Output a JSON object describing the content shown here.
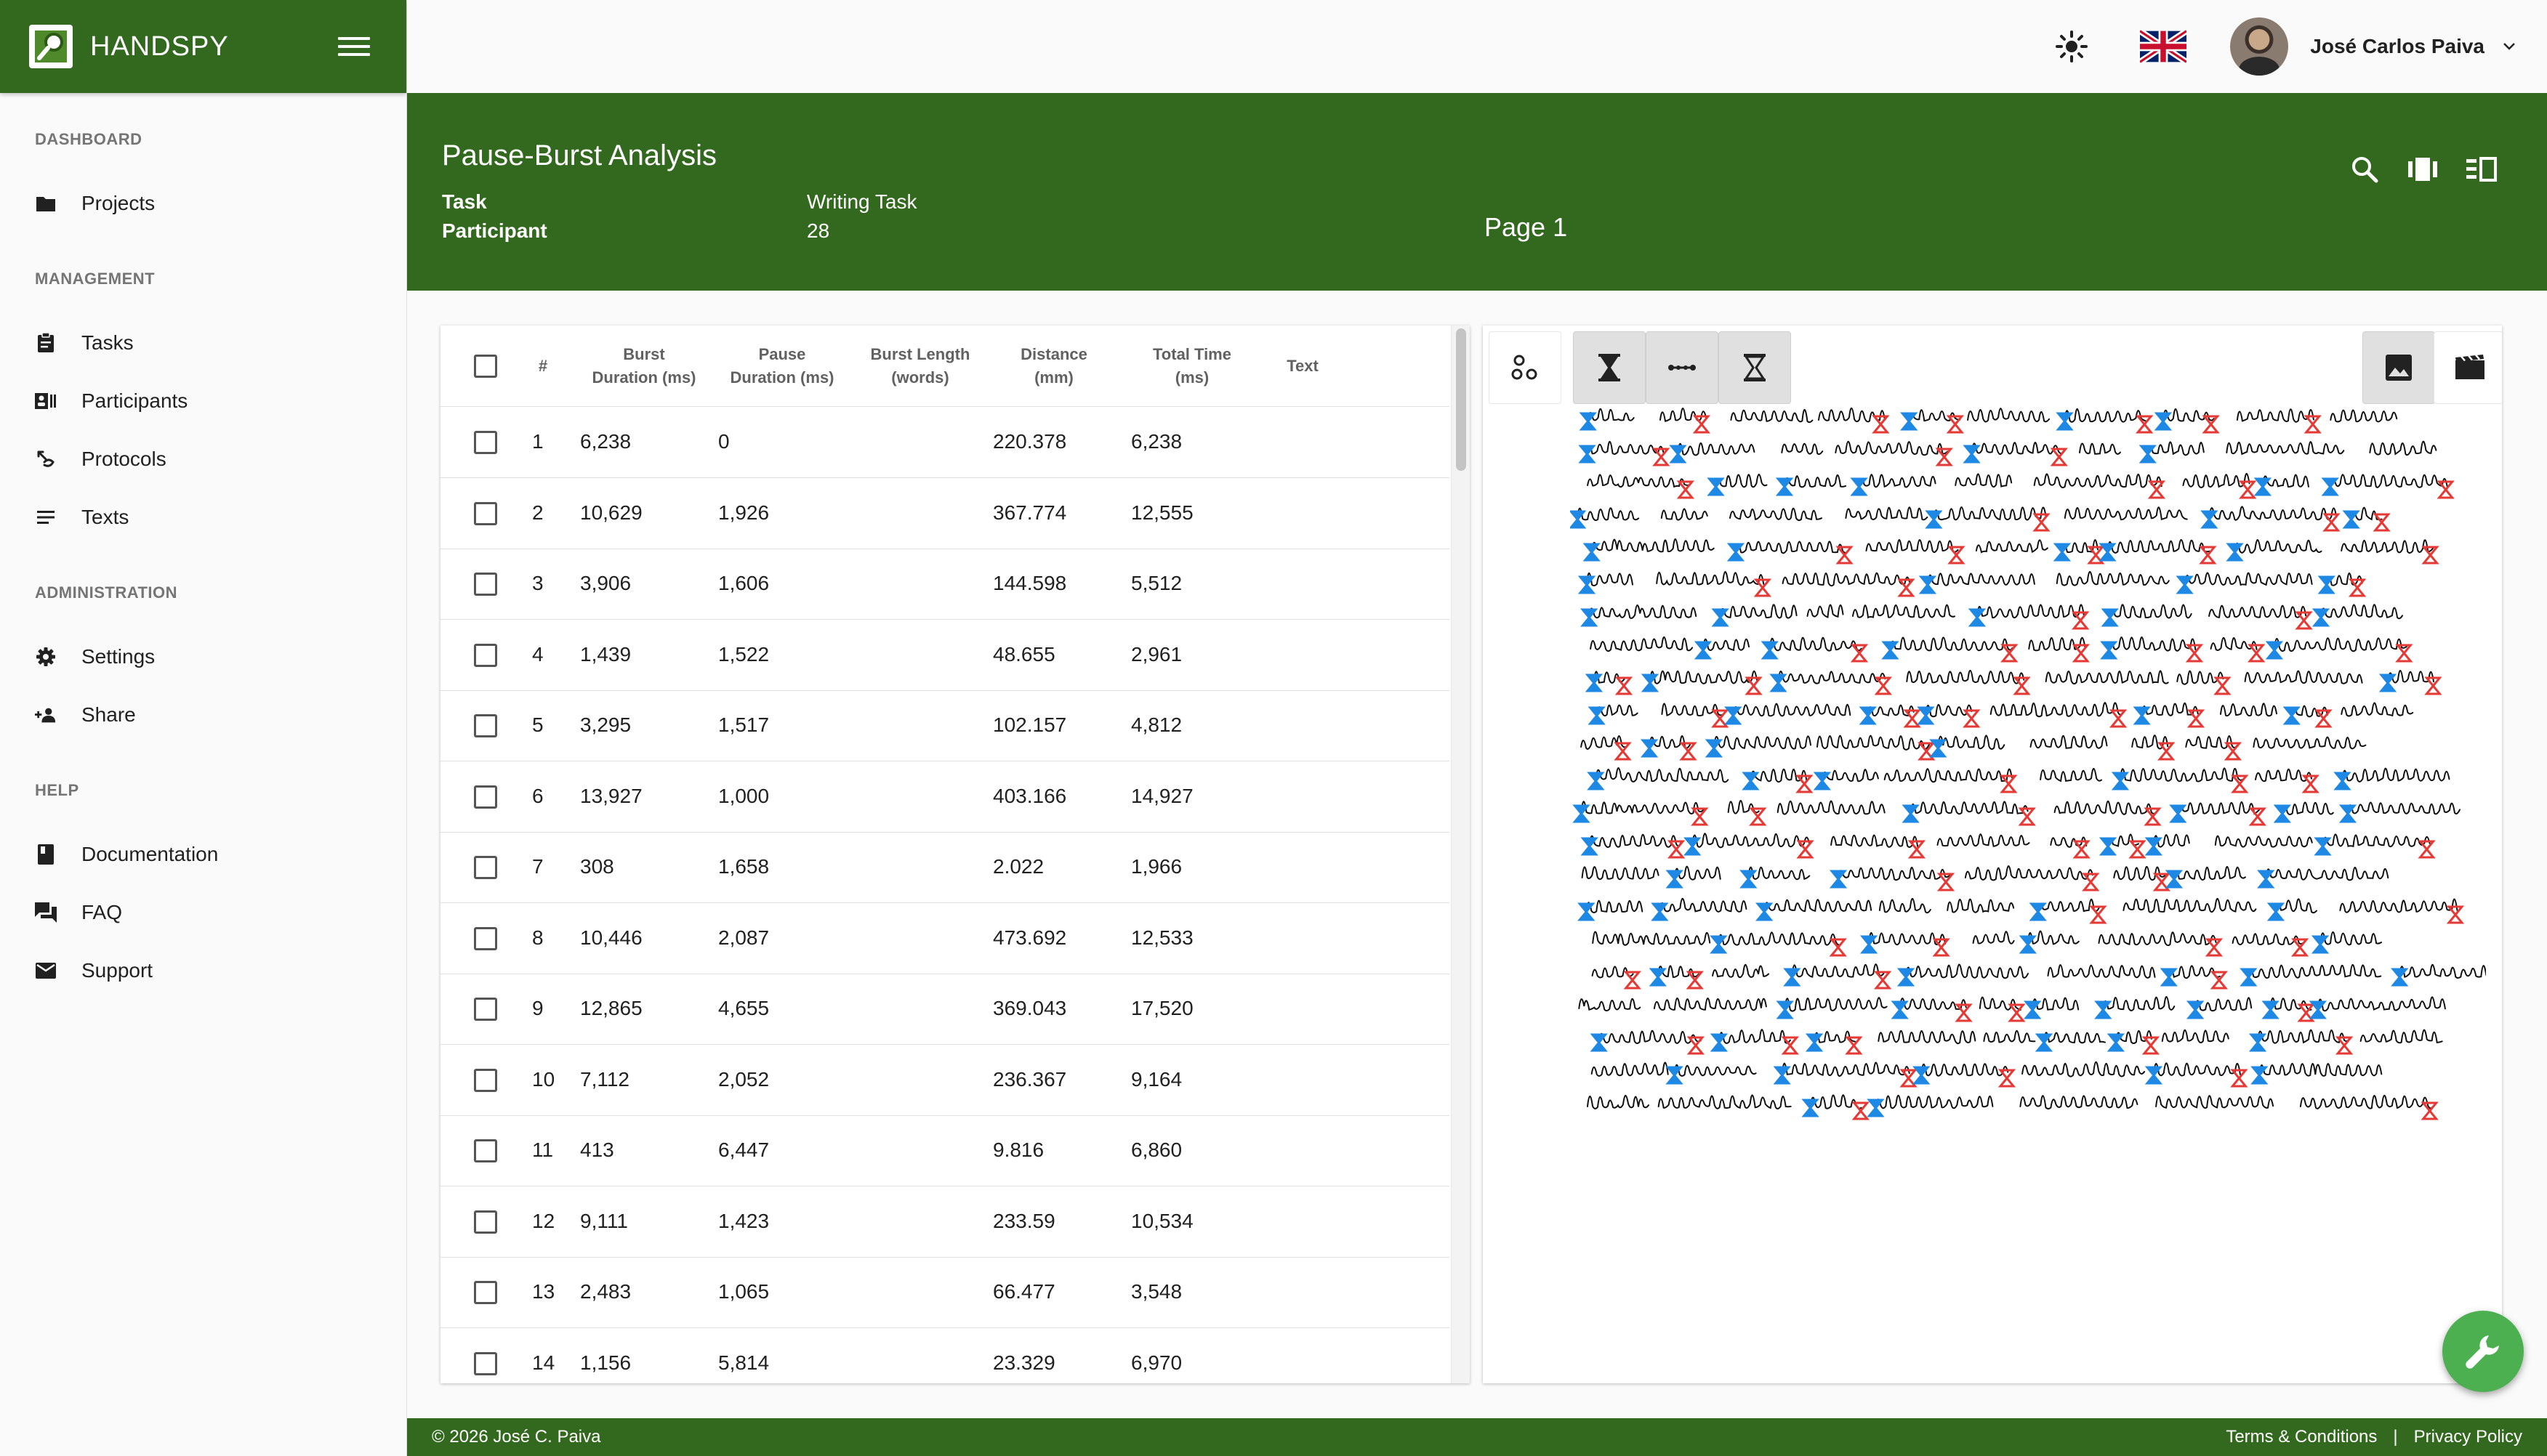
{
  "app": {
    "name": "HANDSPY"
  },
  "topbar": {
    "user_name": "José Carlos Paiva"
  },
  "sidebar": {
    "sections": [
      {
        "title": "DASHBOARD",
        "items": [
          {
            "label": "Projects",
            "icon": "folder-icon"
          }
        ]
      },
      {
        "title": "MANAGEMENT",
        "items": [
          {
            "label": "Tasks",
            "icon": "clipboard-icon"
          },
          {
            "label": "Participants",
            "icon": "contacts-icon"
          },
          {
            "label": "Protocols",
            "icon": "protocol-icon"
          },
          {
            "label": "Texts",
            "icon": "text-lines-icon"
          }
        ]
      },
      {
        "title": "ADMINISTRATION",
        "items": [
          {
            "label": "Settings",
            "icon": "gear-icon"
          },
          {
            "label": "Share",
            "icon": "share-people-icon"
          }
        ]
      },
      {
        "title": "HELP",
        "items": [
          {
            "label": "Documentation",
            "icon": "book-icon"
          },
          {
            "label": "FAQ",
            "icon": "forum-icon"
          },
          {
            "label": "Support",
            "icon": "mail-icon"
          }
        ]
      }
    ]
  },
  "header": {
    "title": "Pause-Burst Analysis",
    "task_label": "Task",
    "task_value": "Writing Task",
    "participant_label": "Participant",
    "participant_value": "28",
    "page": "Page 1"
  },
  "table": {
    "columns": [
      "#",
      "Burst\nDuration (ms)",
      "Pause\nDuration (ms)",
      "Burst Length\n(words)",
      "Distance\n(mm)",
      "Total Time\n(ms)",
      "Text"
    ],
    "rows": [
      {
        "n": "1",
        "burst": "6,238",
        "pause": "0",
        "length": "",
        "distance": "220.378",
        "total": "6,238",
        "text": ""
      },
      {
        "n": "2",
        "burst": "10,629",
        "pause": "1,926",
        "length": "",
        "distance": "367.774",
        "total": "12,555",
        "text": ""
      },
      {
        "n": "3",
        "burst": "3,906",
        "pause": "1,606",
        "length": "",
        "distance": "144.598",
        "total": "5,512",
        "text": ""
      },
      {
        "n": "4",
        "burst": "1,439",
        "pause": "1,522",
        "length": "",
        "distance": "48.655",
        "total": "2,961",
        "text": ""
      },
      {
        "n": "5",
        "burst": "3,295",
        "pause": "1,517",
        "length": "",
        "distance": "102.157",
        "total": "4,812",
        "text": ""
      },
      {
        "n": "6",
        "burst": "13,927",
        "pause": "1,000",
        "length": "",
        "distance": "403.166",
        "total": "14,927",
        "text": ""
      },
      {
        "n": "7",
        "burst": "308",
        "pause": "1,658",
        "length": "",
        "distance": "2.022",
        "total": "1,966",
        "text": ""
      },
      {
        "n": "8",
        "burst": "10,446",
        "pause": "2,087",
        "length": "",
        "distance": "473.692",
        "total": "12,533",
        "text": ""
      },
      {
        "n": "9",
        "burst": "12,865",
        "pause": "4,655",
        "length": "",
        "distance": "369.043",
        "total": "17,520",
        "text": ""
      },
      {
        "n": "10",
        "burst": "7,112",
        "pause": "2,052",
        "length": "",
        "distance": "236.367",
        "total": "9,164",
        "text": ""
      },
      {
        "n": "11",
        "burst": "413",
        "pause": "6,447",
        "length": "",
        "distance": "9.816",
        "total": "6,860",
        "text": ""
      },
      {
        "n": "12",
        "burst": "9,111",
        "pause": "1,423",
        "length": "",
        "distance": "233.59",
        "total": "10,534",
        "text": ""
      },
      {
        "n": "13",
        "burst": "2,483",
        "pause": "1,065",
        "length": "",
        "distance": "66.477",
        "total": "3,548",
        "text": ""
      },
      {
        "n": "14",
        "burst": "1,156",
        "pause": "5,814",
        "length": "",
        "distance": "23.329",
        "total": "6,970",
        "text": ""
      }
    ]
  },
  "handwriting_tools": [
    "scatter-nodes-icon",
    "burst-start-hourglass-icon",
    "pause-line-icon",
    "burst-end-hourglass-icon",
    "image-icon",
    "movie-icon"
  ],
  "footer": {
    "copyright": "© 2026 José C. Paiva",
    "terms": "Terms & Conditions",
    "separator": "|",
    "privacy": "Privacy Policy"
  },
  "colors": {
    "primary": "#33691e",
    "fab": "#4caf50",
    "burst_start": "#1e88e5",
    "burst_end": "#e53935"
  }
}
